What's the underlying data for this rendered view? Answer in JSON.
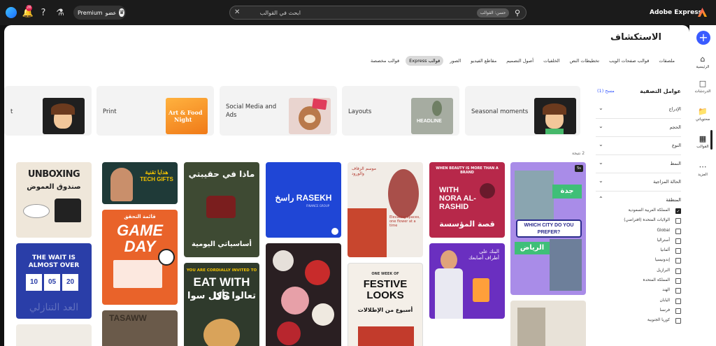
{
  "topbar": {
    "notification_count": "26",
    "premium_label": "Premium",
    "premium_member": "عضو",
    "search_placeholder": "ابحث في القوالب",
    "search_filter_chip": "حسن: القوالب",
    "brand": "Adobe Express"
  },
  "rail": {
    "items": [
      {
        "label": "الرئيسية",
        "icon": "home-icon"
      },
      {
        "label": "الدردشات",
        "icon": "chat-icon"
      },
      {
        "label": "محتوياتي",
        "icon": "folder-icon"
      },
      {
        "label": "القوالب",
        "icon": "templates-icon"
      },
      {
        "label": "المزيد",
        "icon": "more-icon"
      }
    ]
  },
  "page": {
    "title": "الاستكشاف",
    "tabs": [
      {
        "label": "قوالب مخصصة",
        "active": false
      },
      {
        "label": "قوالب Express",
        "active": true
      },
      {
        "label": "الصور",
        "active": false
      },
      {
        "label": "مقاطع الفيديو",
        "active": false
      },
      {
        "label": "أصول التصميم",
        "active": false
      },
      {
        "label": "الخلفيات",
        "active": false
      },
      {
        "label": "تخطيطات النص",
        "active": false
      },
      {
        "label": "قوالب صفحات الويب",
        "active": false
      },
      {
        "label": "ملصقات",
        "active": false
      }
    ],
    "categories": [
      {
        "label": "t"
      },
      {
        "label": "Print"
      },
      {
        "label": "Social Media and Ads"
      },
      {
        "label": "Layouts"
      },
      {
        "label": "Seasonal moments"
      }
    ],
    "results_count": "2 نتيجة"
  },
  "filters": {
    "title": "عوامل التصفية",
    "reset": "مسح (1)",
    "rows": [
      "الإدراج",
      "الحجم",
      "النوع",
      "النمط",
      "الحالة المزاجية"
    ],
    "region_label": "المنطقة",
    "regions": [
      {
        "label": "المملكة العربية السعودية",
        "checked": true
      },
      {
        "label": "الولايات المتحدة (افتراضي)",
        "checked": false
      },
      {
        "label": "Global",
        "checked": false
      },
      {
        "label": "أستراليا",
        "checked": false
      },
      {
        "label": "ألمانيا",
        "checked": false
      },
      {
        "label": "إندونيسيا",
        "checked": false
      },
      {
        "label": "البرازيل",
        "checked": false
      },
      {
        "label": "المملكة المتحدة",
        "checked": false
      },
      {
        "label": "الهند",
        "checked": false
      },
      {
        "label": "اليابان",
        "checked": false
      },
      {
        "label": "فرنسا",
        "checked": false
      },
      {
        "label": "كوريا الجنوبية",
        "checked": false
      }
    ]
  },
  "templates": [
    {
      "name": "unboxing",
      "text": "UNBOXING",
      "sub": "صندوق العموض",
      "bg": "#efe7da",
      "fg": "#333"
    },
    {
      "name": "wait",
      "text": "THE WAIT IS ALMOST OVER",
      "sub": "10 05 20",
      "bg": "#2a3ea8",
      "fg": "#fff"
    },
    {
      "name": "tech-gifts",
      "text": "هدايا تقنية TECH GIFTS",
      "sub": "",
      "bg": "#1f3a38",
      "fg": "#f5c400"
    },
    {
      "name": "game-day",
      "text": "GAME DAY",
      "sub": "قائمة التحقق",
      "bg": "#e9632a",
      "fg": "#fff"
    },
    {
      "name": "bag",
      "text": "ماذا في حقيبتي",
      "sub": "أساسياتي اليومية",
      "bg": "#3e4a33",
      "fg": "#fff"
    },
    {
      "name": "eat",
      "text": "EAT WITH US",
      "sub": "تعالوا نأكل سوا",
      "bg": "#2f3a2c",
      "fg": "#fff"
    },
    {
      "name": "rasekh",
      "text": "راسخ RASEKH",
      "sub": "FINANCE GROUP",
      "bg": "#1f46d6",
      "fg": "#fff"
    },
    {
      "name": "flowers",
      "text": "",
      "sub": "",
      "bg": "#2a1f22",
      "fg": "#fff"
    },
    {
      "name": "decorators",
      "text": "موسم الزفاف والورود",
      "sub": "Elevating spaces, one flower at a time",
      "bg": "#f1ece6",
      "fg": "#b2362c"
    },
    {
      "name": "festive",
      "text": "FESTIVE LOOKS",
      "sub": "أسبوع من الإطلالات",
      "bg": "#f4efe8",
      "fg": "#111"
    },
    {
      "name": "nora",
      "text": "WITH NORA AL-RASHID",
      "sub": "قصة المؤسسة",
      "bg": "#b7284a",
      "fg": "#fff"
    },
    {
      "name": "bank",
      "text": "البنك على أطراف أصابعك",
      "sub": "",
      "bg": "#6a2fc0",
      "fg": "#fff"
    },
    {
      "name": "city",
      "text": "WHICH CITY DO YOU PREFER?",
      "sub": "جدة الرياض",
      "bg": "#a98ce8",
      "fg": "#2b2b8c"
    },
    {
      "name": "misc",
      "text": "",
      "sub": "",
      "bg": "#e8e2d8",
      "fg": "#333"
    }
  ]
}
